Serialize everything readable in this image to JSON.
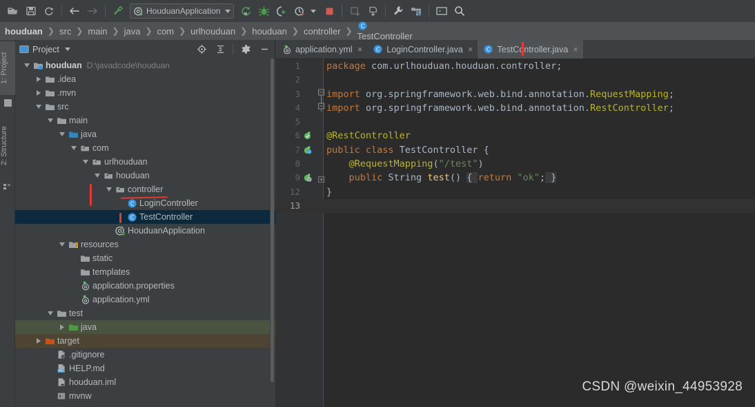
{
  "toolbar": {
    "icons": [
      {
        "name": "open-folder-icon",
        "glyph": "open"
      },
      {
        "name": "save-all-icon",
        "glyph": "save"
      },
      {
        "name": "sync-refresh-icon",
        "glyph": "sync"
      },
      {
        "name": "back-arrow-icon",
        "glyph": "back"
      },
      {
        "name": "forward-arrow-icon",
        "glyph": "forward"
      },
      {
        "name": "build-hammer-icon",
        "glyph": "hammer"
      }
    ],
    "run_config": {
      "label": "HouduanApplication",
      "icon": "spring-boot-icon"
    },
    "run_icons": [
      {
        "name": "run-button",
        "glyph": "run"
      },
      {
        "name": "debug-button",
        "glyph": "debug"
      },
      {
        "name": "run-with-coverage-button",
        "glyph": "coverage"
      },
      {
        "name": "profiler-button",
        "glyph": "profiler"
      },
      {
        "name": "stop-button",
        "glyph": "stop"
      }
    ],
    "right_icons": [
      {
        "name": "update-project-icon",
        "glyph": "update"
      },
      {
        "name": "commit-icon",
        "glyph": "commit"
      },
      {
        "name": "settings-wrench-icon",
        "glyph": "wrench"
      },
      {
        "name": "project-structure-icon",
        "glyph": "structure"
      },
      {
        "name": "terminal-icon",
        "glyph": "terminal"
      },
      {
        "name": "search-everywhere-icon",
        "glyph": "search"
      }
    ]
  },
  "breadcrumb": {
    "items": [
      {
        "label": "houduan",
        "bold": true,
        "icon": ""
      },
      {
        "label": "src",
        "bold": false,
        "icon": ""
      },
      {
        "label": "main",
        "bold": false,
        "icon": ""
      },
      {
        "label": "java",
        "bold": false,
        "icon": ""
      },
      {
        "label": "com",
        "bold": false,
        "icon": ""
      },
      {
        "label": "urlhouduan",
        "bold": false,
        "icon": ""
      },
      {
        "label": "houduan",
        "bold": false,
        "icon": ""
      },
      {
        "label": "controller",
        "bold": false,
        "icon": ""
      },
      {
        "label": "TestController",
        "bold": false,
        "icon": "java-class-icon"
      }
    ],
    "separator": "❯"
  },
  "tool_windows": {
    "left_tabs": [
      {
        "label": "1: Project",
        "selected": true
      },
      {
        "label": "2: Structure",
        "selected": false
      }
    ]
  },
  "project_panel": {
    "title": "Project",
    "title_icon": "project-view-icon",
    "dropdown_icon": "chevron-down-icon",
    "header_buttons": [
      {
        "name": "select-opened-file-button",
        "glyph": "target"
      },
      {
        "name": "collapse-all-button",
        "glyph": "collapse"
      },
      {
        "name": "settings-gear-button",
        "glyph": "gear"
      },
      {
        "name": "hide-panel-button",
        "glyph": "minus"
      }
    ],
    "tree": [
      {
        "label": "houduan",
        "path": "D:\\javadcode\\houduan",
        "indent": 0,
        "twisty": "down",
        "icon": "module-folder-icon",
        "bold": true,
        "state": "normal"
      },
      {
        "label": ".idea",
        "path": "",
        "indent": 1,
        "twisty": "right",
        "icon": "folder-icon",
        "bold": false,
        "state": "normal"
      },
      {
        "label": ".mvn",
        "path": "",
        "indent": 1,
        "twisty": "right",
        "icon": "folder-icon",
        "bold": false,
        "state": "normal"
      },
      {
        "label": "src",
        "path": "",
        "indent": 1,
        "twisty": "down",
        "icon": "folder-icon",
        "bold": false,
        "state": "normal"
      },
      {
        "label": "main",
        "path": "",
        "indent": 2,
        "twisty": "down",
        "icon": "folder-icon",
        "bold": false,
        "state": "normal"
      },
      {
        "label": "java",
        "path": "",
        "indent": 3,
        "twisty": "down",
        "icon": "source-root-icon",
        "bold": false,
        "state": "normal"
      },
      {
        "label": "com",
        "path": "",
        "indent": 4,
        "twisty": "down",
        "icon": "package-icon",
        "bold": false,
        "state": "normal"
      },
      {
        "label": "urlhouduan",
        "path": "",
        "indent": 5,
        "twisty": "down",
        "icon": "package-icon",
        "bold": false,
        "state": "normal"
      },
      {
        "label": "houduan",
        "path": "",
        "indent": 6,
        "twisty": "down",
        "icon": "package-icon",
        "bold": false,
        "state": "normal"
      },
      {
        "label": "controller",
        "path": "",
        "indent": 7,
        "twisty": "down",
        "icon": "package-icon",
        "bold": false,
        "state": "normal"
      },
      {
        "label": "LoginController",
        "path": "",
        "indent": 8,
        "twisty": "none",
        "icon": "java-class-icon",
        "bold": false,
        "state": "normal"
      },
      {
        "label": "TestController",
        "path": "",
        "indent": 8,
        "twisty": "none",
        "icon": "java-class-icon",
        "bold": false,
        "state": "selected"
      },
      {
        "label": "HouduanApplication",
        "path": "",
        "indent": 7,
        "twisty": "none",
        "icon": "spring-boot-class-icon",
        "bold": false,
        "state": "normal"
      },
      {
        "label": "resources",
        "path": "",
        "indent": 3,
        "twisty": "down",
        "icon": "resource-root-icon",
        "bold": false,
        "state": "normal"
      },
      {
        "label": "static",
        "path": "",
        "indent": 4,
        "twisty": "none",
        "icon": "folder-icon",
        "bold": false,
        "state": "normal"
      },
      {
        "label": "templates",
        "path": "",
        "indent": 4,
        "twisty": "none",
        "icon": "folder-icon",
        "bold": false,
        "state": "normal"
      },
      {
        "label": "application.properties",
        "path": "",
        "indent": 4,
        "twisty": "none",
        "icon": "spring-config-icon",
        "bold": false,
        "state": "normal"
      },
      {
        "label": "application.yml",
        "path": "",
        "indent": 4,
        "twisty": "none",
        "icon": "spring-config-icon",
        "bold": false,
        "state": "normal"
      },
      {
        "label": "test",
        "path": "",
        "indent": 2,
        "twisty": "down",
        "icon": "folder-icon",
        "bold": false,
        "state": "normal"
      },
      {
        "label": "java",
        "path": "",
        "indent": 3,
        "twisty": "right",
        "icon": "test-source-root-icon",
        "bold": false,
        "state": "test-root"
      },
      {
        "label": "target",
        "path": "",
        "indent": 1,
        "twisty": "right",
        "icon": "excluded-folder-icon",
        "bold": false,
        "state": "excluded"
      },
      {
        "label": ".gitignore",
        "path": "",
        "indent": 2,
        "twisty": "none",
        "icon": "gitignore-file-icon",
        "bold": false,
        "state": "normal"
      },
      {
        "label": "HELP.md",
        "path": "",
        "indent": 2,
        "twisty": "none",
        "icon": "markdown-file-icon",
        "bold": false,
        "state": "normal"
      },
      {
        "label": "houduan.iml",
        "path": "",
        "indent": 2,
        "twisty": "none",
        "icon": "iml-file-icon",
        "bold": false,
        "state": "normal"
      },
      {
        "label": "mvnw",
        "path": "",
        "indent": 2,
        "twisty": "none",
        "icon": "script-file-icon",
        "bold": false,
        "state": "normal"
      }
    ]
  },
  "editor": {
    "tabs": [
      {
        "label": "application.yml",
        "icon": "spring-config-icon",
        "active": false,
        "close": "×"
      },
      {
        "label": "LoginController.java",
        "icon": "java-class-icon",
        "active": false,
        "close": "×"
      },
      {
        "label": "TestController.java",
        "icon": "java-class-icon",
        "active": true,
        "close": "×"
      }
    ],
    "lines": [
      {
        "num": "1",
        "gutter_icon": "",
        "fold": "",
        "current": false,
        "tokens": [
          {
            "t": "package ",
            "c": "kw"
          },
          {
            "t": "com.urlhouduan.houduan.controller;",
            "c": "pln"
          }
        ]
      },
      {
        "num": "2",
        "gutter_icon": "",
        "fold": "",
        "current": false,
        "tokens": []
      },
      {
        "num": "3",
        "gutter_icon": "",
        "fold": "fold-start",
        "current": false,
        "tokens": [
          {
            "t": "import ",
            "c": "kw"
          },
          {
            "t": "org.springframework.web.bind.annotation.",
            "c": "pln"
          },
          {
            "t": "RequestMapping",
            "c": "ann"
          },
          {
            "t": ";",
            "c": "pln"
          }
        ]
      },
      {
        "num": "4",
        "gutter_icon": "",
        "fold": "fold-end",
        "current": false,
        "tokens": [
          {
            "t": "import ",
            "c": "kw"
          },
          {
            "t": "org.springframework.web.bind.annotation.",
            "c": "pln"
          },
          {
            "t": "RestController",
            "c": "ann"
          },
          {
            "t": ";",
            "c": "pln"
          }
        ]
      },
      {
        "num": "5",
        "gutter_icon": "",
        "fold": "",
        "current": false,
        "tokens": []
      },
      {
        "num": "6",
        "gutter_icon": "spring-bean-icon",
        "fold": "",
        "current": false,
        "tokens": [
          {
            "t": "@RestController",
            "c": "ann"
          }
        ]
      },
      {
        "num": "7",
        "gutter_icon": "spring-bean-class-icon",
        "fold": "",
        "current": false,
        "tokens": [
          {
            "t": "public class ",
            "c": "kw"
          },
          {
            "t": "TestController ",
            "c": "cls"
          },
          {
            "t": "{",
            "c": "pln"
          }
        ]
      },
      {
        "num": "8",
        "gutter_icon": "",
        "fold": "",
        "current": false,
        "tokens": [
          {
            "t": "    @RequestMapping",
            "c": "ann"
          },
          {
            "t": "(",
            "c": "pln"
          },
          {
            "t": "\"/test\"",
            "c": "str"
          },
          {
            "t": ")",
            "c": "pln"
          }
        ]
      },
      {
        "num": "9",
        "gutter_icon": "spring-mapping-icon",
        "fold": "fold-collapsed",
        "current": false,
        "tokens": [
          {
            "t": "    public ",
            "c": "kw"
          },
          {
            "t": "String ",
            "c": "cls"
          },
          {
            "t": "test",
            "c": "meth"
          },
          {
            "t": "() ",
            "c": "pln"
          },
          {
            "t": "{ ",
            "c": "folded-brace"
          },
          {
            "t": "return ",
            "c": "kw"
          },
          {
            "t": "\"ok\"",
            "c": "str"
          },
          {
            "t": ";",
            "c": "pln"
          },
          {
            "t": " }",
            "c": "folded-brace"
          }
        ]
      },
      {
        "num": "12",
        "gutter_icon": "",
        "fold": "",
        "current": false,
        "tokens": [
          {
            "t": "}",
            "c": "pln"
          }
        ]
      },
      {
        "num": "13",
        "gutter_icon": "",
        "fold": "",
        "current": true,
        "tokens": []
      }
    ]
  },
  "annotations": {
    "controller_underline": true,
    "controller_vline": true,
    "testcontroller_vline": true,
    "tab_caret": true,
    "color": "#e53935"
  },
  "watermark": {
    "text": "CSDN @weixin_44953928"
  }
}
